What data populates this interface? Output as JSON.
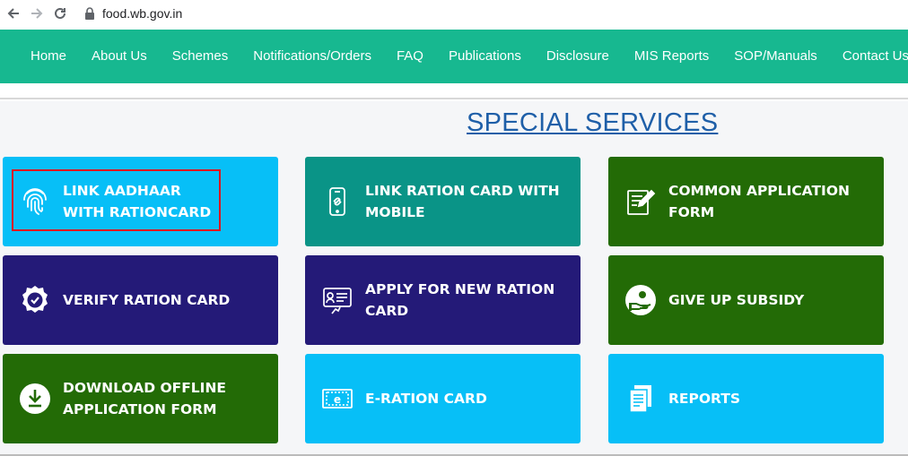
{
  "browser": {
    "url": "food.wb.gov.in"
  },
  "nav": {
    "items": [
      {
        "label": "Home"
      },
      {
        "label": "About Us"
      },
      {
        "label": "Schemes"
      },
      {
        "label": "Notifications/Orders"
      },
      {
        "label": "FAQ"
      },
      {
        "label": "Publications"
      },
      {
        "label": "Disclosure"
      },
      {
        "label": "MIS Reports"
      },
      {
        "label": "SOP/Manuals"
      },
      {
        "label": "Contact Us"
      }
    ]
  },
  "section": {
    "title": "SPECIAL SERVICES"
  },
  "tiles": [
    {
      "label": "LINK AADHAAR WITH RATIONCARD",
      "icon": "fingerprint-icon",
      "color": "#07bff7"
    },
    {
      "label": "LINK RATION CARD WITH MOBILE",
      "icon": "mobile-link-icon",
      "color": "#0a9487"
    },
    {
      "label": "COMMON APPLICATION FORM",
      "icon": "form-edit-icon",
      "color": "#236b06"
    },
    {
      "label": "VERIFY RATION CARD",
      "icon": "verified-badge-icon",
      "color": "#241a78"
    },
    {
      "label": "APPLY FOR NEW RATION CARD",
      "icon": "apply-card-icon",
      "color": "#241a78"
    },
    {
      "label": "GIVE UP SUBSIDY",
      "icon": "give-up-hand-icon",
      "color": "#236b06"
    },
    {
      "label": "DOWNLOAD OFFLINE APPLICATION FORM",
      "icon": "download-icon",
      "color": "#236b06"
    },
    {
      "label": "E-RATION CARD",
      "icon": "e-card-icon",
      "color": "#07bff7"
    },
    {
      "label": "REPORTS",
      "icon": "reports-icon",
      "color": "#07bff7"
    }
  ],
  "colors": {
    "nav_bg": "#17b890",
    "title": "#1f5fa8",
    "highlight": "#e0141e"
  }
}
